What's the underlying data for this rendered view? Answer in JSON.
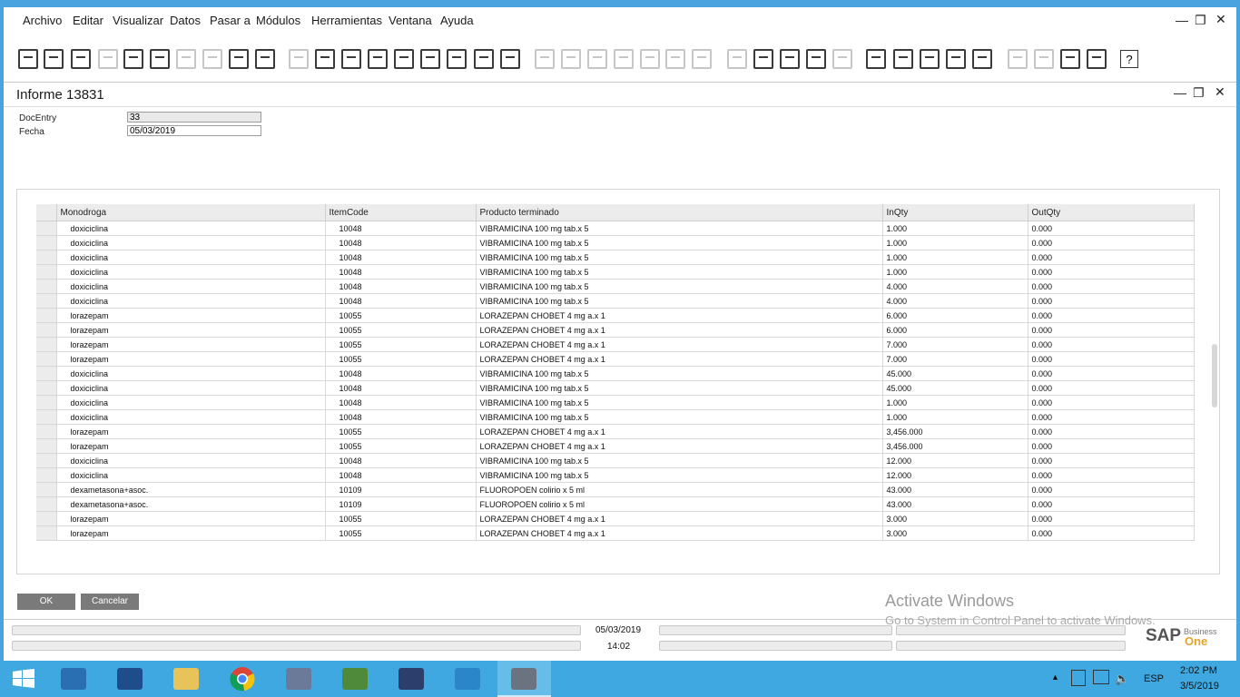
{
  "menu": [
    "Archivo",
    "Editar",
    "Visualizar",
    "Datos",
    "Pasar a",
    "Módulos",
    "Herramientas",
    "Ventana",
    "Ayuda"
  ],
  "window_title": "Informe 13831",
  "fields": {
    "docentry_label": "DocEntry",
    "docentry_value": "33",
    "fecha_label": "Fecha",
    "fecha_value": "05/03/2019"
  },
  "grid": {
    "columns": [
      "Monodroga",
      "ItemCode",
      "Producto terminado",
      "InQty",
      "OutQty"
    ],
    "rows": [
      [
        "doxiciclina",
        "10048",
        "VIBRAMICINA 100 mg tab.x 5",
        "1.000",
        "0.000"
      ],
      [
        "doxiciclina",
        "10048",
        "VIBRAMICINA 100 mg tab.x 5",
        "1.000",
        "0.000"
      ],
      [
        "doxiciclina",
        "10048",
        "VIBRAMICINA 100 mg tab.x 5",
        "1.000",
        "0.000"
      ],
      [
        "doxiciclina",
        "10048",
        "VIBRAMICINA 100 mg tab.x 5",
        "1.000",
        "0.000"
      ],
      [
        "doxiciclina",
        "10048",
        "VIBRAMICINA 100 mg tab.x 5",
        "4.000",
        "0.000"
      ],
      [
        "doxiciclina",
        "10048",
        "VIBRAMICINA 100 mg tab.x 5",
        "4.000",
        "0.000"
      ],
      [
        "lorazepam",
        "10055",
        "LORAZEPAN CHOBET 4 mg a.x 1",
        "6.000",
        "0.000"
      ],
      [
        "lorazepam",
        "10055",
        "LORAZEPAN CHOBET 4 mg a.x 1",
        "6.000",
        "0.000"
      ],
      [
        "lorazepam",
        "10055",
        "LORAZEPAN CHOBET 4 mg a.x 1",
        "7.000",
        "0.000"
      ],
      [
        "lorazepam",
        "10055",
        "LORAZEPAN CHOBET 4 mg a.x 1",
        "7.000",
        "0.000"
      ],
      [
        "doxiciclina",
        "10048",
        "VIBRAMICINA 100 mg tab.x 5",
        "45.000",
        "0.000"
      ],
      [
        "doxiciclina",
        "10048",
        "VIBRAMICINA 100 mg tab.x 5",
        "45.000",
        "0.000"
      ],
      [
        "doxiciclina",
        "10048",
        "VIBRAMICINA 100 mg tab.x 5",
        "1.000",
        "0.000"
      ],
      [
        "doxiciclina",
        "10048",
        "VIBRAMICINA 100 mg tab.x 5",
        "1.000",
        "0.000"
      ],
      [
        "lorazepam",
        "10055",
        "LORAZEPAN CHOBET 4 mg a.x 1",
        "3,456.000",
        "0.000"
      ],
      [
        "lorazepam",
        "10055",
        "LORAZEPAN CHOBET 4 mg a.x 1",
        "3,456.000",
        "0.000"
      ],
      [
        "doxiciclina",
        "10048",
        "VIBRAMICINA 100 mg tab.x 5",
        "12.000",
        "0.000"
      ],
      [
        "doxiciclina",
        "10048",
        "VIBRAMICINA 100 mg tab.x 5",
        "12.000",
        "0.000"
      ],
      [
        "dexametasona+asoc.",
        "10109",
        "FLUOROPOEN colirio x 5 ml",
        "43.000",
        "0.000"
      ],
      [
        "dexametasona+asoc.",
        "10109",
        "FLUOROPOEN colirio x 5 ml",
        "43.000",
        "0.000"
      ],
      [
        "lorazepam",
        "10055",
        "LORAZEPAN CHOBET 4 mg a.x 1",
        "3.000",
        "0.000"
      ],
      [
        "lorazepam",
        "10055",
        "LORAZEPAN CHOBET 4 mg a.x 1",
        "3.000",
        "0.000"
      ]
    ]
  },
  "buttons": {
    "ok": "OK",
    "cancel": "Cancelar"
  },
  "status": {
    "date": "05/03/2019",
    "time": "14:02"
  },
  "watermark": {
    "line1": "Activate Windows",
    "line2": "Go to System in Control Panel to activate Windows."
  },
  "brand": {
    "sap": "SAP",
    "business": "Business",
    "one": "One"
  },
  "tray": {
    "lang": "ESP",
    "time": "2:02 PM",
    "date": "3/5/2019"
  },
  "icons": {
    "toolbar": [
      "preview-icon",
      "print-icon",
      "email-icon",
      "sms-icon",
      "fax-icon",
      "excel-icon",
      "word-icon",
      "pdf-icon",
      "move-icon",
      "lock-icon",
      "binoculars-icon",
      "add-icon",
      "first-record-icon",
      "previous-record-icon",
      "next-record-icon",
      "last-record-icon",
      "refresh-icon",
      "filter-icon",
      "sort-icon",
      "base-document-icon",
      "target-document-icon",
      "payment-icon",
      "cash-icon",
      "calculator-icon",
      "gross-profit-icon",
      "query-icon",
      "edit-icon",
      "settings-icon",
      "form-settings-icon",
      "messages-icon",
      "alerts-icon",
      "approval-icon",
      "message-alert-icon",
      "calendar-icon",
      "org-icon",
      "user-icon",
      "dashboard-icon",
      "widget-icon",
      "chart-icon",
      "drill-icon",
      "help-icon"
    ],
    "dim": [
      3,
      6,
      7,
      10,
      19,
      20,
      21,
      22,
      23,
      24,
      25,
      26,
      30,
      36,
      37
    ]
  }
}
